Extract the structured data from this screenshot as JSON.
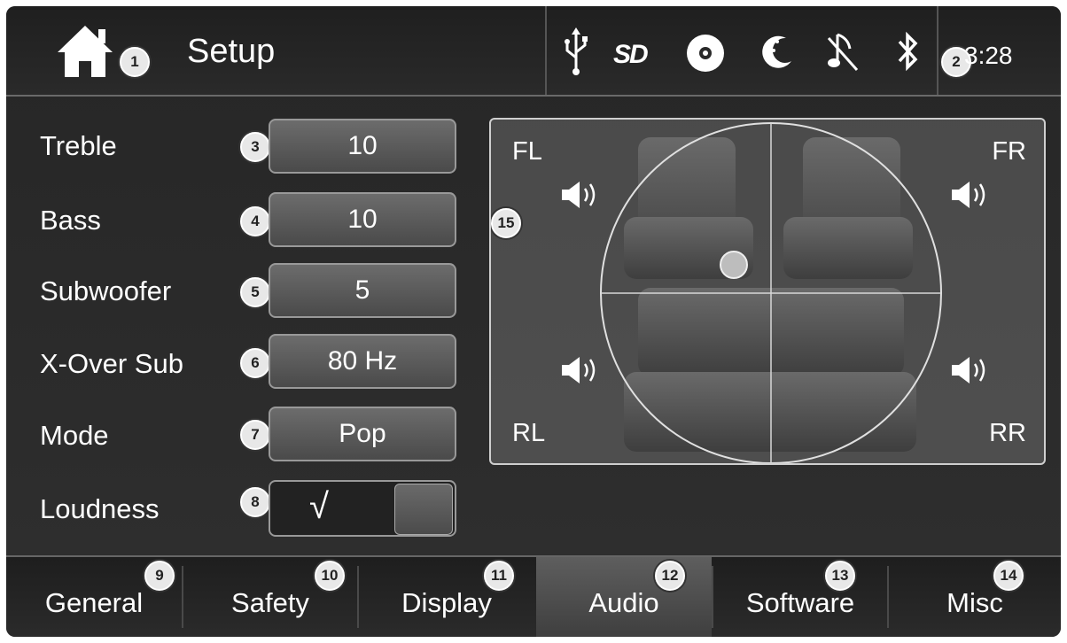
{
  "header": {
    "title": "Setup",
    "time": "3:28",
    "icons": [
      "home-icon",
      "usb-icon",
      "sd-icon",
      "disc-icon",
      "dimmer-icon",
      "mute-icon",
      "bluetooth-icon"
    ],
    "sd_text": "SD"
  },
  "callouts": [
    "1",
    "2",
    "3",
    "4",
    "5",
    "6",
    "7",
    "8",
    "9",
    "10",
    "11",
    "12",
    "13",
    "14",
    "15"
  ],
  "audio": {
    "treble": {
      "label": "Treble",
      "value": "10"
    },
    "bass": {
      "label": "Bass",
      "value": "10"
    },
    "subwoofer": {
      "label": "Subwoofer",
      "value": "5"
    },
    "xover": {
      "label": "X-Over Sub",
      "value": "80 Hz"
    },
    "mode": {
      "label": "Mode",
      "value": "Pop"
    },
    "loudness": {
      "label": "Loudness",
      "checked": true,
      "check_glyph": "√"
    }
  },
  "balance": {
    "fl": "FL",
    "fr": "FR",
    "rl": "RL",
    "rr": "RR"
  },
  "tabs": [
    {
      "label": "General"
    },
    {
      "label": "Safety"
    },
    {
      "label": "Display"
    },
    {
      "label": "Audio",
      "active": true
    },
    {
      "label": "Software"
    },
    {
      "label": "Misc"
    }
  ]
}
